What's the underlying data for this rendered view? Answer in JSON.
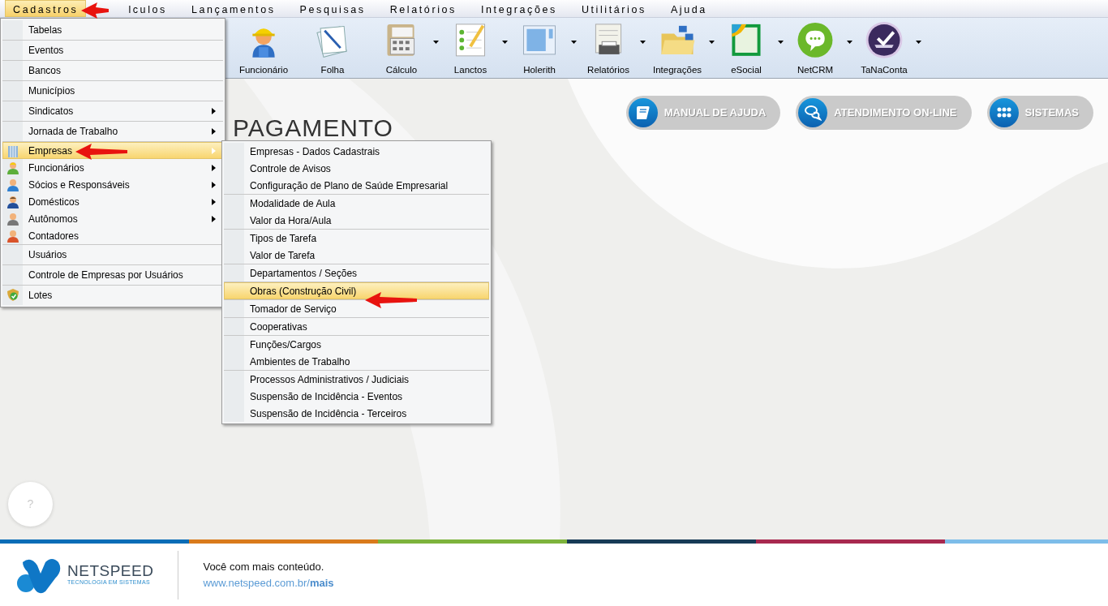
{
  "menubar": [
    {
      "label": "Cadastros",
      "selected": true
    },
    {
      "label": "lculos",
      "selected": false
    },
    {
      "label": "Lançamentos",
      "selected": false
    },
    {
      "label": "Pesquisas",
      "selected": false
    },
    {
      "label": "Relatórios",
      "selected": false
    },
    {
      "label": "Integrações",
      "selected": false
    },
    {
      "label": "Utilitários",
      "selected": false
    },
    {
      "label": "Ajuda",
      "selected": false
    }
  ],
  "toolbar": [
    {
      "label": "Funcionário",
      "kind": "worker",
      "dropdown": false
    },
    {
      "label": "Folha",
      "kind": "papers",
      "dropdown": false
    },
    {
      "label": "Cálculo",
      "kind": "calculator",
      "dropdown": true
    },
    {
      "label": "Lanctos",
      "kind": "checklist",
      "dropdown": true
    },
    {
      "label": "Holerith",
      "kind": "window",
      "dropdown": true
    },
    {
      "label": "Relatórios",
      "kind": "printer",
      "dropdown": true
    },
    {
      "label": "Integrações",
      "kind": "folder",
      "dropdown": true
    },
    {
      "label": "eSocial",
      "kind": "esocial",
      "dropdown": true
    },
    {
      "label": "NetCRM",
      "kind": "chat",
      "dropdown": true
    },
    {
      "label": "TaNaConta",
      "kind": "tray",
      "dropdown": true
    }
  ],
  "quick_buttons": [
    {
      "label": "MANUAL DE AJUDA",
      "kind": "book"
    },
    {
      "label": "ATENDIMENTO ON-LINE",
      "kind": "chat"
    },
    {
      "label": "SISTEMAS",
      "kind": "grid"
    }
  ],
  "heading": "PAGAMENTO",
  "menu": [
    [
      {
        "label": "Tabelas",
        "submenu": false,
        "selected": false
      }
    ],
    [
      {
        "label": "Eventos",
        "submenu": false,
        "selected": false
      }
    ],
    [
      {
        "label": "Bancos",
        "submenu": false,
        "selected": false
      }
    ],
    [
      {
        "label": "Municípios",
        "submenu": false,
        "selected": false
      }
    ],
    [
      {
        "label": "Sindicatos",
        "submenu": true,
        "selected": false
      }
    ],
    [
      {
        "label": "Jornada de Trabalho",
        "submenu": true,
        "selected": false
      }
    ],
    [
      {
        "label": "Empresas",
        "submenu": true,
        "selected": true,
        "kind": "building"
      },
      {
        "label": "Funcionários",
        "submenu": true,
        "selected": false,
        "kind": "worker"
      },
      {
        "label": "Sócios e Responsáveis",
        "submenu": true,
        "selected": false,
        "kind": "partner"
      },
      {
        "label": "Domésticos",
        "submenu": true,
        "selected": false,
        "kind": "domestic"
      },
      {
        "label": "Autônomos",
        "submenu": true,
        "selected": false,
        "kind": "freelancer"
      },
      {
        "label": "Contadores",
        "submenu": false,
        "selected": false,
        "kind": "accountant"
      }
    ],
    [
      {
        "label": "Usuários",
        "submenu": false,
        "selected": false
      }
    ],
    [
      {
        "label": "Controle de Empresas por Usuários",
        "submenu": false,
        "selected": false
      }
    ],
    [
      {
        "label": "Lotes",
        "submenu": false,
        "selected": false,
        "kind": "lot"
      }
    ]
  ],
  "submenu": [
    [
      {
        "label": "Empresas - Dados Cadastrais",
        "selected": false
      },
      {
        "label": "Controle de Avisos",
        "selected": false
      },
      {
        "label": "Configuração de Plano de Saúde Empresarial",
        "selected": false
      }
    ],
    [
      {
        "label": "Modalidade de Aula",
        "selected": false
      },
      {
        "label": "Valor da Hora/Aula",
        "selected": false
      }
    ],
    [
      {
        "label": "Tipos de Tarefa",
        "selected": false
      },
      {
        "label": "Valor de Tarefa",
        "selected": false
      }
    ],
    [
      {
        "label": "Departamentos / Seções",
        "selected": false
      }
    ],
    [
      {
        "label": "Obras (Construção Civil)",
        "selected": true
      }
    ],
    [
      {
        "label": "Tomador de Serviço",
        "selected": false
      }
    ],
    [
      {
        "label": "Cooperativas",
        "selected": false
      }
    ],
    [
      {
        "label": "Funções/Cargos",
        "selected": false
      },
      {
        "label": "Ambientes de Trabalho",
        "selected": false
      }
    ],
    [
      {
        "label": "Processos Administrativos / Judiciais",
        "selected": false
      },
      {
        "label": "Suspensão de Incidência - Eventos",
        "selected": false
      },
      {
        "label": "Suspensão de Incidência - Terceiros",
        "selected": false
      }
    ]
  ],
  "help_button": "?",
  "footer": {
    "brand": "NETSPEED",
    "brand_tagline": "TECNOLOGIA EM SISTEMAS",
    "tagline": "Você com mais conteúdo.",
    "link": "www.netspeed.com.br/**mais**"
  }
}
